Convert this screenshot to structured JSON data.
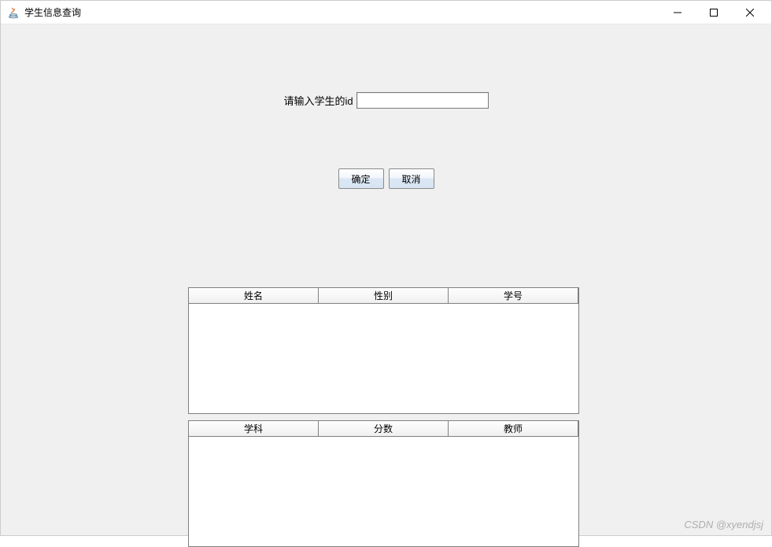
{
  "window": {
    "title": "学生信息查询"
  },
  "form": {
    "input_label": "请输入学生的id",
    "input_value": "",
    "ok_button": "确定",
    "cancel_button": "取消"
  },
  "table1": {
    "headers": [
      "姓名",
      "性别",
      "学号"
    ],
    "rows": []
  },
  "table2": {
    "headers": [
      "学科",
      "分数",
      "教师"
    ],
    "rows": []
  },
  "watermark": "CSDN @xyendjsj"
}
